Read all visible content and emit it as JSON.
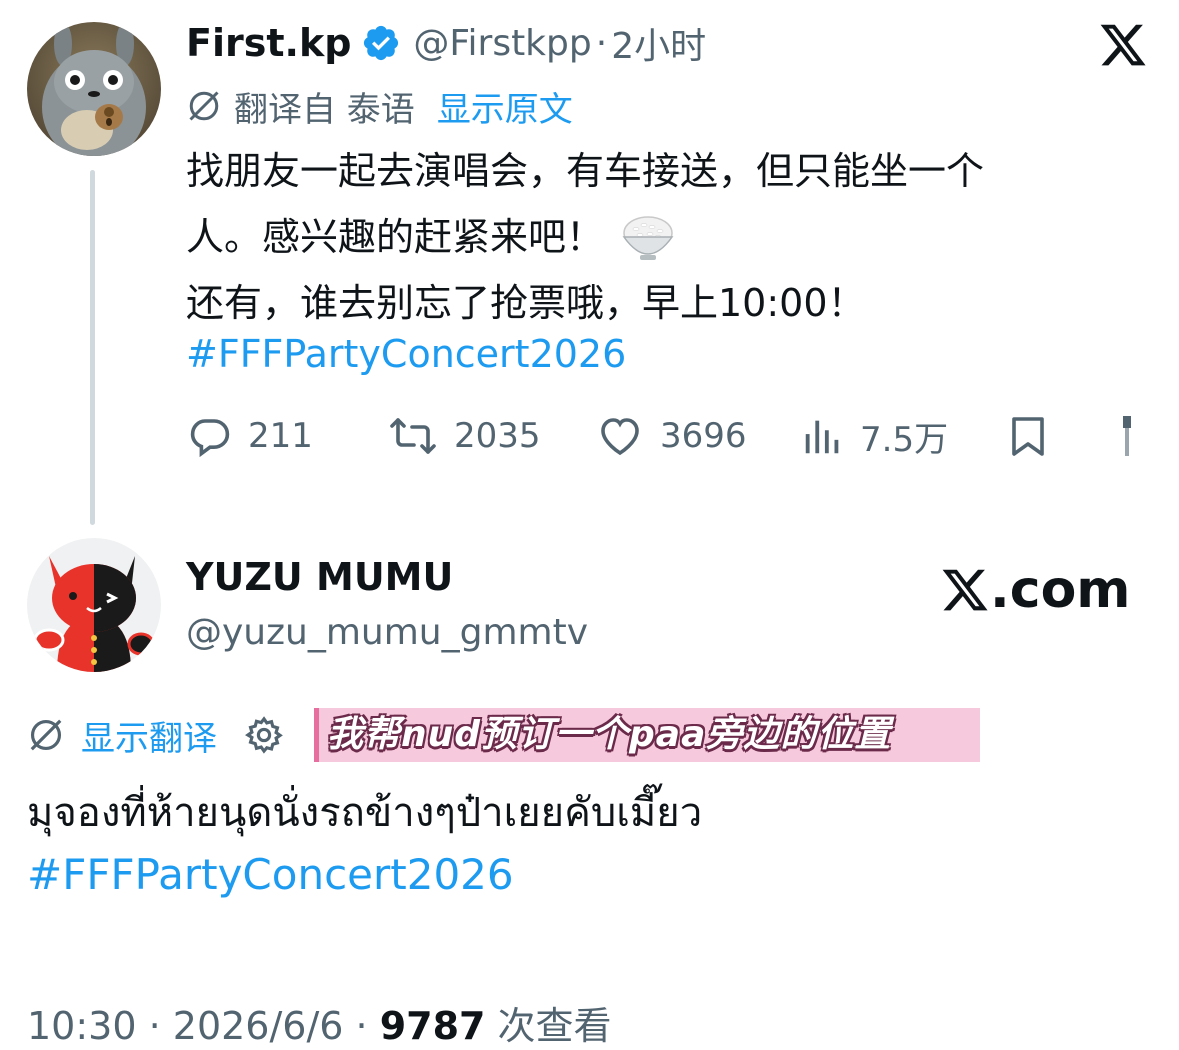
{
  "tweet1": {
    "name": "First.kp",
    "handle": "@Firstkpp",
    "separator": "·",
    "time": "2小时",
    "translated_from": "翻译自 泰语",
    "show_original": "显示原文",
    "lines": [
      "找朋友一起去演唱会，有车接送，但只能坐一个",
      "人。感兴趣的赶紧来吧！",
      "还有，谁去别忘了抢票哦，早上10:00！"
    ],
    "emoji": "🍚",
    "hashtag": "#FFFPartyConcert2026",
    "actions": {
      "replies": "211",
      "retweets": "2035",
      "likes": "3696",
      "views": "7.5万"
    }
  },
  "tweet2": {
    "name": "YUZU MUMU",
    "handle": "@yuzu_mumu_gmmtv",
    "watermark": ".com",
    "show_translation": "显示翻译",
    "overlay_caption": "我帮nud预订一个paa旁边的位置",
    "text": "มุจองที่ห้ายนุดนั่งรถข้างๆป๋าเยยคับเมี๊ยว",
    "hashtag": "#FFFPartyConcert2026",
    "footer": {
      "time": "10:30",
      "sep1": " · ",
      "date": "2026/6/6",
      "sep2": " · ",
      "views": "9787",
      "views_label": " 次查看"
    }
  },
  "colors": {
    "link": "#1d9bf0",
    "secondary": "#536471",
    "primary": "#0f1419",
    "thread_line": "#cfd9de",
    "overlay_bg": "#f7c9dc"
  },
  "icons": [
    "totoro-avatar",
    "verified-badge-icon",
    "x-logo-icon",
    "translate-icon",
    "reply-icon",
    "retweet-icon",
    "like-icon",
    "views-icon",
    "bookmark-icon",
    "share-icon",
    "cat-avatar",
    "settings-gear-icon"
  ]
}
